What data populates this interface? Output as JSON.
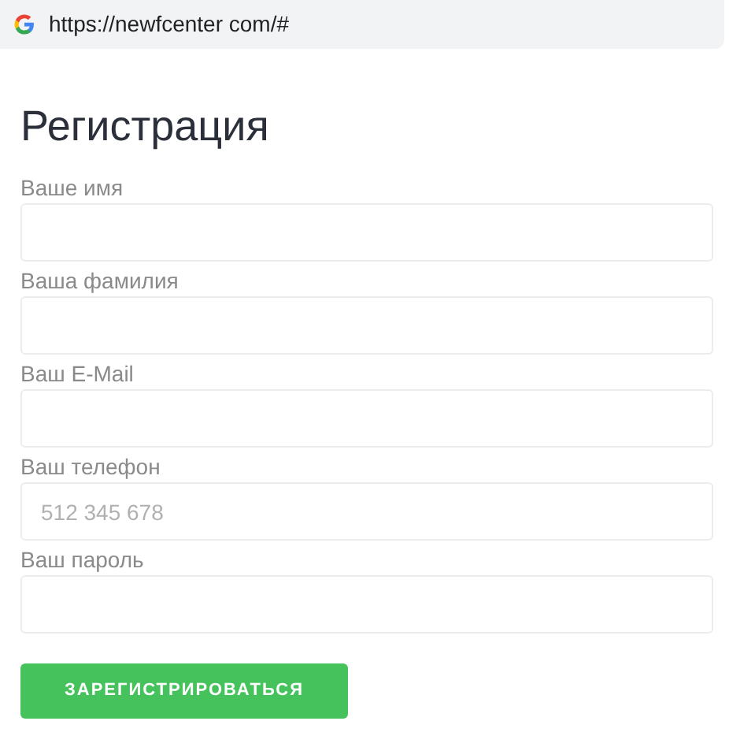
{
  "address_bar": {
    "url": "https://newfcenter com/#"
  },
  "title": "Регистрация",
  "fields": [
    {
      "label": "Ваше имя"
    },
    {
      "label": "Ваша фамилия"
    },
    {
      "label": "Ваш E-Mail"
    },
    {
      "label": "Ваш телефон",
      "placeholder": "512 345 678"
    },
    {
      "label": "Ваш пароль"
    }
  ],
  "submit_button": "ЗАРЕГИСТРИРОВАТЬСЯ"
}
